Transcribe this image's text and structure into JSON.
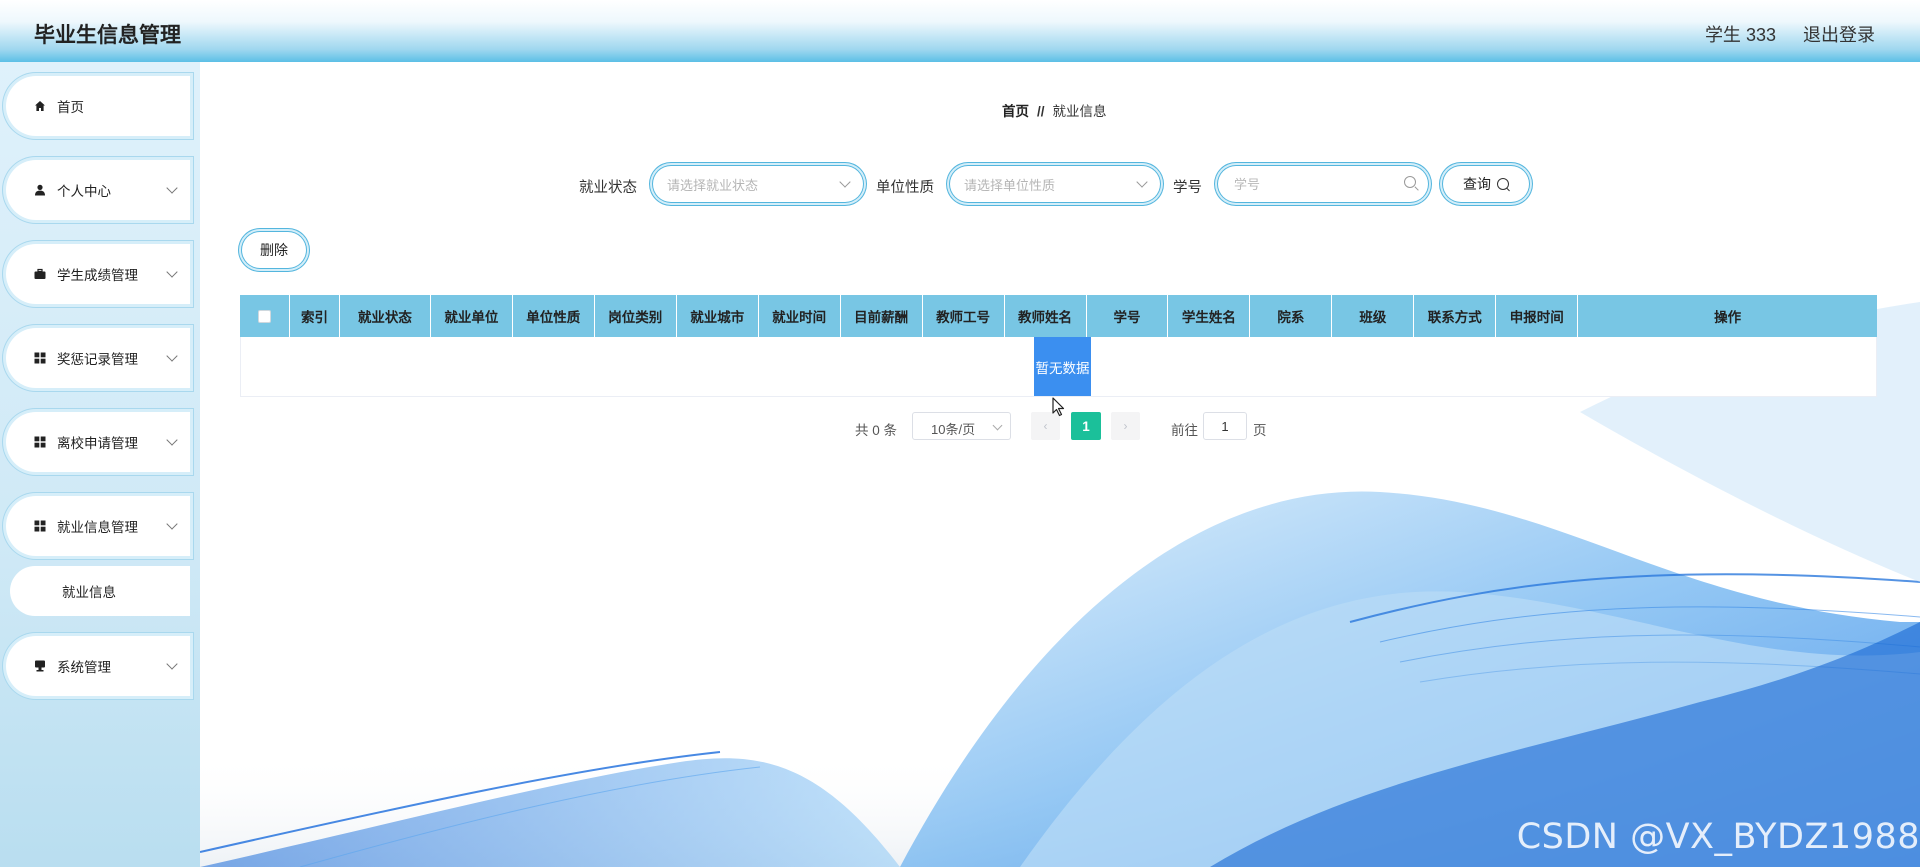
{
  "header": {
    "title": "毕业生信息管理",
    "user": "学生 333",
    "logout": "退出登录"
  },
  "sidebar": {
    "items": [
      {
        "label": "首页",
        "icon": "home-icon"
      },
      {
        "label": "个人中心",
        "icon": "user-icon"
      },
      {
        "label": "学生成绩管理",
        "icon": "briefcase-icon"
      },
      {
        "label": "奖惩记录管理",
        "icon": "grid-icon"
      },
      {
        "label": "离校申请管理",
        "icon": "grid-icon"
      },
      {
        "label": "就业信息管理",
        "icon": "grid-icon"
      },
      {
        "label": "系统管理",
        "icon": "computer-icon"
      }
    ],
    "submenu": {
      "label": "就业信息"
    }
  },
  "breadcrumb": {
    "home": "首页",
    "separator": "//",
    "current": "就业信息"
  },
  "search": {
    "status_label": "就业状态",
    "status_placeholder": "请选择就业状态",
    "unit_type_label": "单位性质",
    "unit_type_placeholder": "请选择单位性质",
    "student_id_label": "学号",
    "student_id_placeholder": "学号",
    "query_button": "查询"
  },
  "toolbar": {
    "delete_button": "删除"
  },
  "table": {
    "columns": [
      "索引",
      "就业状态",
      "就业单位",
      "单位性质",
      "岗位类别",
      "就业城市",
      "就业时间",
      "目前薪酬",
      "教师工号",
      "教师姓名",
      "学号",
      "学生姓名",
      "院系",
      "班级",
      "联系方式",
      "申报时间",
      "操作"
    ],
    "empty_text": "暂无数据"
  },
  "pagination": {
    "total": "共 0 条",
    "page_size": "10条/页",
    "current_page": "1",
    "goto_label": "前往",
    "goto_value": "1",
    "goto_unit": "页"
  },
  "watermark": "CSDN @VX_BYDZ1988",
  "colors": {
    "header_gradient": "#5cbfe6",
    "table_header": "#78c6e4",
    "active_page": "#1bc09a",
    "empty_highlight": "#3b8ff0",
    "border_accent": "#54b6de"
  }
}
